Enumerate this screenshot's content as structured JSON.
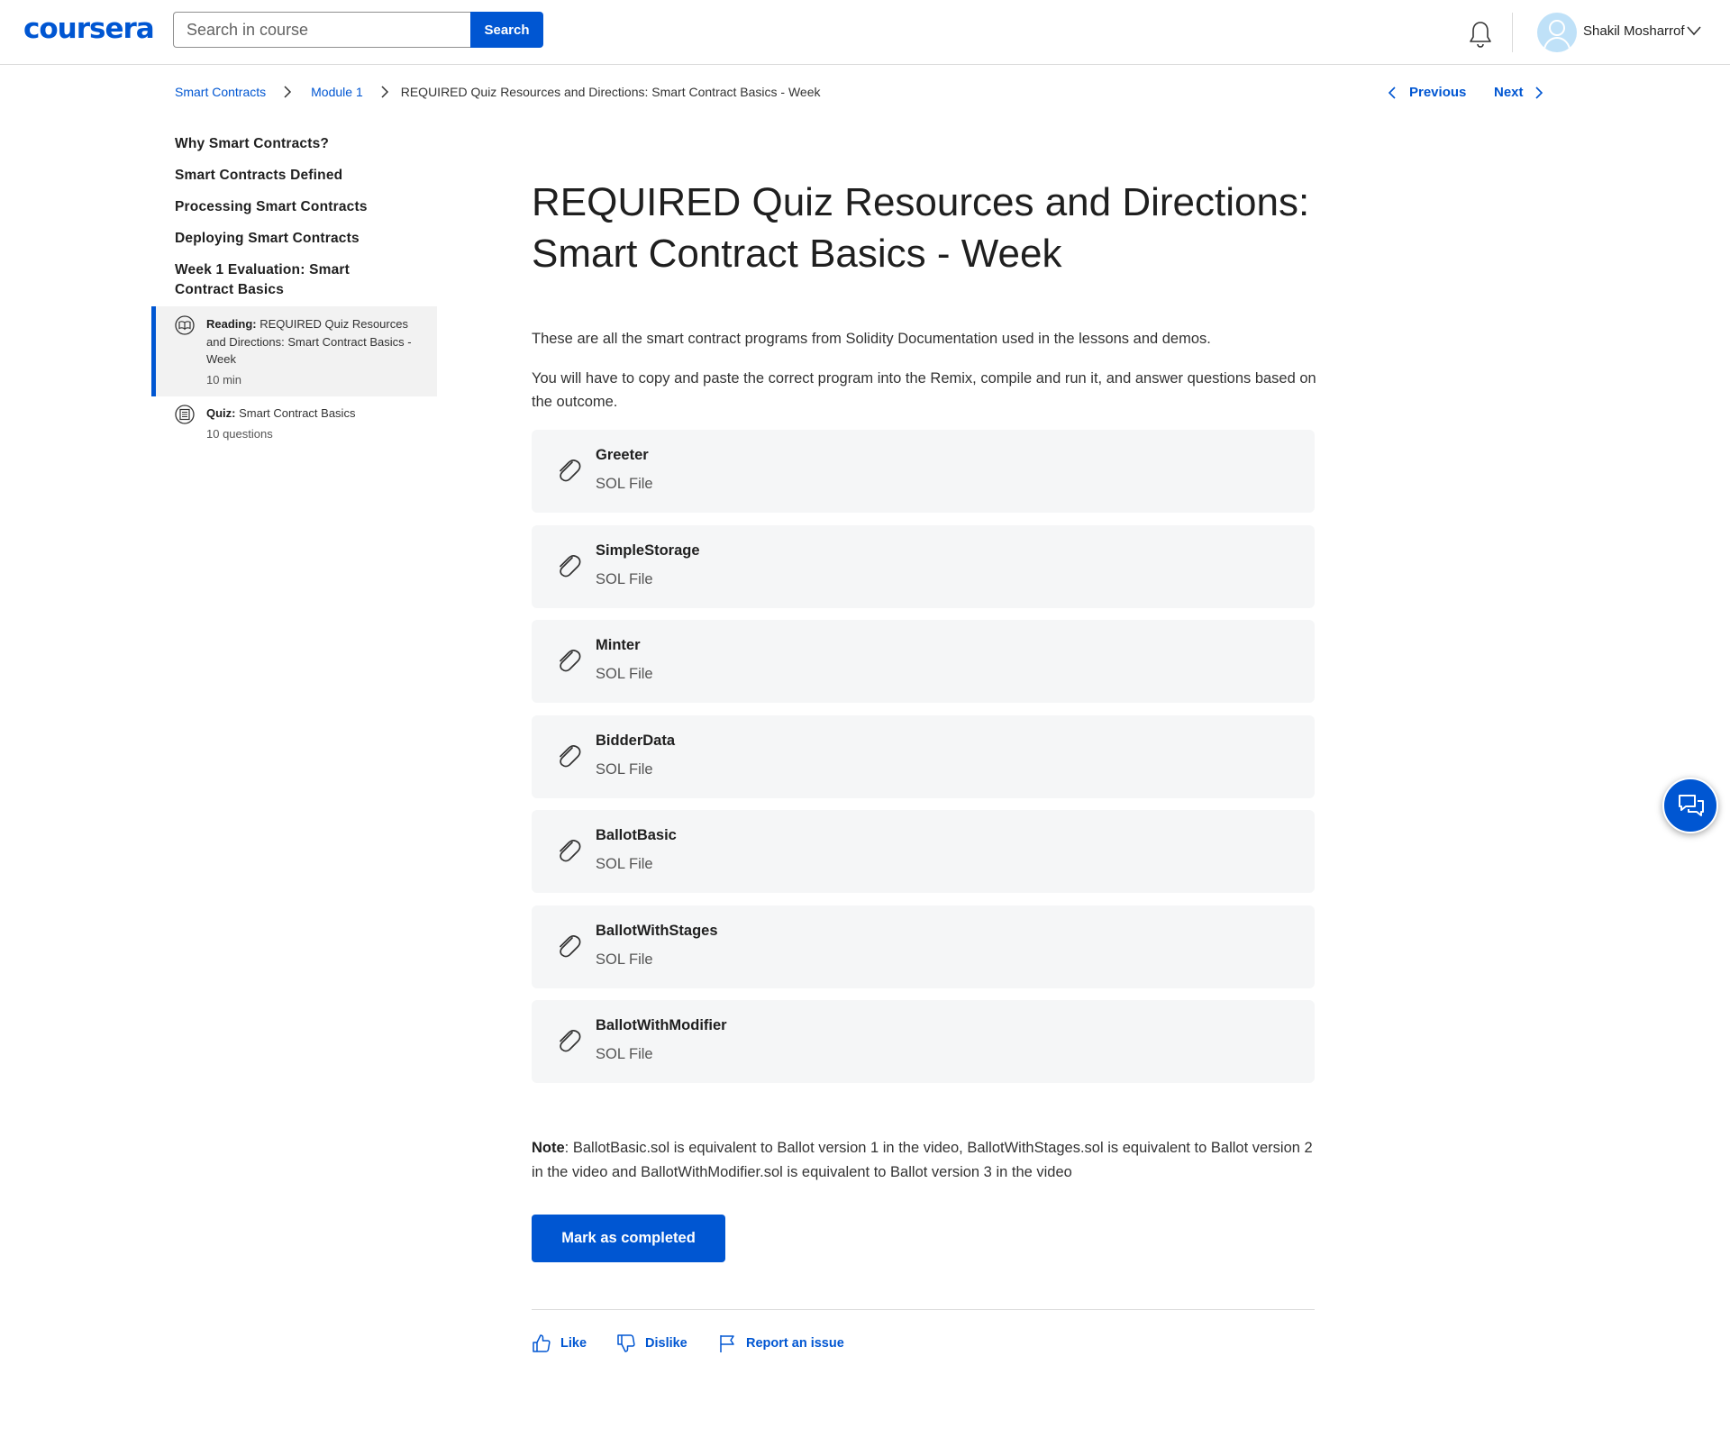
{
  "header": {
    "logo": "coursera",
    "search_placeholder": "Search in course",
    "search_button": "Search",
    "user_name": "Shakil Mosharrof"
  },
  "breadcrumb": {
    "items": [
      "Smart Contracts",
      "Module 1"
    ],
    "current": "REQUIRED Quiz Resources and Directions: Smart Contract Basics - Week"
  },
  "nav": {
    "previous": "Previous",
    "next": "Next"
  },
  "sidebar": {
    "items": [
      "Why Smart Contracts?",
      "Smart Contracts Defined",
      "Processing Smart Contracts",
      "Deploying Smart Contracts",
      "Week 1 Evaluation: Smart Contract Basics"
    ],
    "sub_items": [
      {
        "kind": "Reading:",
        "title": "REQUIRED Quiz Resources and Directions: Smart Contract Basics - Week",
        "meta": "10 min",
        "active": true,
        "icon": "reading-icon"
      },
      {
        "kind": "Quiz:",
        "title": "Smart Contract Basics",
        "meta": "10 questions",
        "active": false,
        "icon": "quiz-icon"
      }
    ]
  },
  "main": {
    "title": "REQUIRED Quiz Resources and Directions: Smart Contract Basics - Week",
    "intro": "These are all the smart contract programs from Solidity Documentation used in the lessons and demos.",
    "directions": "You will have to copy and paste the correct program into the Remix, compile and run it, and answer questions based on the outcome.",
    "files": [
      {
        "name": "Greeter",
        "type": "SOL File"
      },
      {
        "name": "SimpleStorage",
        "type": "SOL File"
      },
      {
        "name": "Minter",
        "type": "SOL File"
      },
      {
        "name": "BidderData",
        "type": "SOL File"
      },
      {
        "name": "BallotBasic",
        "type": "SOL File"
      },
      {
        "name": "BallotWithStages",
        "type": "SOL File"
      },
      {
        "name": "BallotWithModifier",
        "type": "SOL File"
      }
    ],
    "note_label": "Note",
    "note_text": ": BallotBasic.sol is equivalent to Ballot version 1 in the video, BallotWithStages.sol is equivalent to Ballot version 2 in the video and BallotWithModifier.sol is equivalent to Ballot version 3 in the video",
    "complete_button": "Mark as completed"
  },
  "feedback": {
    "like": "Like",
    "dislike": "Dislike",
    "report": "Report an issue"
  },
  "colors": {
    "brand": "#0056d2",
    "card_bg": "#f5f6f7",
    "active_bg": "#f2f2f2"
  }
}
